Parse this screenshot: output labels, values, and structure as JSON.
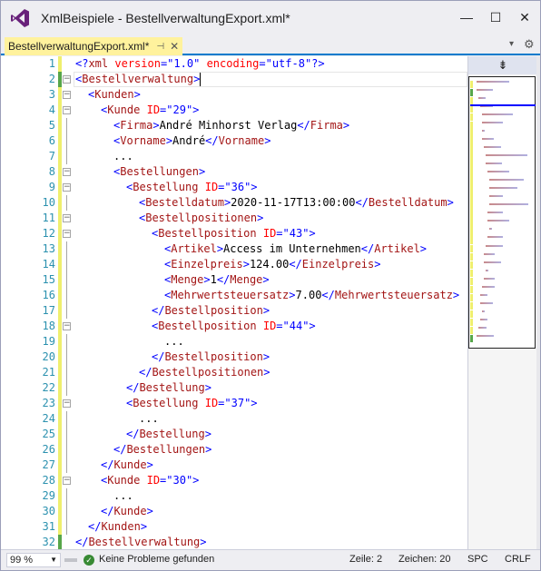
{
  "window": {
    "title": "XmlBeispiele - BestellverwaltungExport.xml*",
    "minimize_glyph": "—",
    "maximize_glyph": "☐",
    "close_glyph": "✕"
  },
  "tab": {
    "label": "BestellverwaltungExport.xml*",
    "pin_glyph": "⊣",
    "close_glyph": "✕",
    "dropdown_glyph": "▾",
    "gear_glyph": "⚙",
    "accent": "#fff29d"
  },
  "editor": {
    "lines": [
      {
        "n": "1",
        "indent": 0,
        "tokens": [
          [
            "b",
            "<?"
          ],
          [
            "el",
            "xml"
          ],
          [
            "tx",
            " "
          ],
          [
            "at",
            "version"
          ],
          [
            "b",
            "=\""
          ],
          [
            "av",
            "1.0"
          ],
          [
            "b",
            "\""
          ],
          [
            "tx",
            " "
          ],
          [
            "at",
            "encoding"
          ],
          [
            "b",
            "=\""
          ],
          [
            "av",
            "utf-8"
          ],
          [
            "b",
            "\"?>"
          ]
        ]
      },
      {
        "n": "2",
        "indent": 0,
        "fold": "−",
        "tokens": [
          [
            "b",
            "<"
          ],
          [
            "el",
            "Bestellverwaltung"
          ],
          [
            "b",
            ">"
          ]
        ],
        "caret": true
      },
      {
        "n": "3",
        "indent": 1,
        "fold": "−",
        "tokens": [
          [
            "b",
            "<"
          ],
          [
            "el",
            "Kunden"
          ],
          [
            "b",
            ">"
          ]
        ]
      },
      {
        "n": "4",
        "indent": 2,
        "fold": "−",
        "tokens": [
          [
            "b",
            "<"
          ],
          [
            "el",
            "Kunde"
          ],
          [
            "tx",
            " "
          ],
          [
            "at",
            "ID"
          ],
          [
            "b",
            "=\""
          ],
          [
            "av",
            "29"
          ],
          [
            "b",
            "\">"
          ]
        ]
      },
      {
        "n": "5",
        "indent": 3,
        "tokens": [
          [
            "b",
            "<"
          ],
          [
            "el",
            "Firma"
          ],
          [
            "b",
            ">"
          ],
          [
            "tx",
            "André Minhorst Verlag"
          ],
          [
            "b",
            "</"
          ],
          [
            "el",
            "Firma"
          ],
          [
            "b",
            ">"
          ]
        ]
      },
      {
        "n": "6",
        "indent": 3,
        "tokens": [
          [
            "b",
            "<"
          ],
          [
            "el",
            "Vorname"
          ],
          [
            "b",
            ">"
          ],
          [
            "tx",
            "André"
          ],
          [
            "b",
            "</"
          ],
          [
            "el",
            "Vorname"
          ],
          [
            "b",
            ">"
          ]
        ]
      },
      {
        "n": "7",
        "indent": 3,
        "tokens": [
          [
            "tx",
            "..."
          ]
        ]
      },
      {
        "n": "8",
        "indent": 3,
        "fold": "−",
        "tokens": [
          [
            "b",
            "<"
          ],
          [
            "el",
            "Bestellungen"
          ],
          [
            "b",
            ">"
          ]
        ]
      },
      {
        "n": "9",
        "indent": 4,
        "fold": "−",
        "tokens": [
          [
            "b",
            "<"
          ],
          [
            "el",
            "Bestellung"
          ],
          [
            "tx",
            " "
          ],
          [
            "at",
            "ID"
          ],
          [
            "b",
            "=\""
          ],
          [
            "av",
            "36"
          ],
          [
            "b",
            "\">"
          ]
        ]
      },
      {
        "n": "10",
        "indent": 5,
        "tokens": [
          [
            "b",
            "<"
          ],
          [
            "el",
            "Bestelldatum"
          ],
          [
            "b",
            ">"
          ],
          [
            "tx",
            "2020-11-17T13:00:00"
          ],
          [
            "b",
            "</"
          ],
          [
            "el",
            "Bestelldatum"
          ],
          [
            "b",
            ">"
          ]
        ]
      },
      {
        "n": "11",
        "indent": 5,
        "fold": "−",
        "tokens": [
          [
            "b",
            "<"
          ],
          [
            "el",
            "Bestellpositionen"
          ],
          [
            "b",
            ">"
          ]
        ]
      },
      {
        "n": "12",
        "indent": 6,
        "fold": "−",
        "tokens": [
          [
            "b",
            "<"
          ],
          [
            "el",
            "Bestellposition"
          ],
          [
            "tx",
            " "
          ],
          [
            "at",
            "ID"
          ],
          [
            "b",
            "=\""
          ],
          [
            "av",
            "43"
          ],
          [
            "b",
            "\">"
          ]
        ]
      },
      {
        "n": "13",
        "indent": 7,
        "tokens": [
          [
            "b",
            "<"
          ],
          [
            "el",
            "Artikel"
          ],
          [
            "b",
            ">"
          ],
          [
            "tx",
            "Access im Unternehmen"
          ],
          [
            "b",
            "</"
          ],
          [
            "el",
            "Artikel"
          ],
          [
            "b",
            ">"
          ]
        ]
      },
      {
        "n": "14",
        "indent": 7,
        "tokens": [
          [
            "b",
            "<"
          ],
          [
            "el",
            "Einzelpreis"
          ],
          [
            "b",
            ">"
          ],
          [
            "tx",
            "124.00"
          ],
          [
            "b",
            "</"
          ],
          [
            "el",
            "Einzelpreis"
          ],
          [
            "b",
            ">"
          ]
        ]
      },
      {
        "n": "15",
        "indent": 7,
        "tokens": [
          [
            "b",
            "<"
          ],
          [
            "el",
            "Menge"
          ],
          [
            "b",
            ">"
          ],
          [
            "tx",
            "1"
          ],
          [
            "b",
            "</"
          ],
          [
            "el",
            "Menge"
          ],
          [
            "b",
            ">"
          ]
        ]
      },
      {
        "n": "16",
        "indent": 7,
        "tokens": [
          [
            "b",
            "<"
          ],
          [
            "el",
            "Mehrwertsteuersatz"
          ],
          [
            "b",
            ">"
          ],
          [
            "tx",
            "7.00"
          ],
          [
            "b",
            "</"
          ],
          [
            "el",
            "Mehrwertsteuersatz"
          ],
          [
            "b",
            ">"
          ]
        ]
      },
      {
        "n": "17",
        "indent": 6,
        "tokens": [
          [
            "b",
            "</"
          ],
          [
            "el",
            "Bestellposition"
          ],
          [
            "b",
            ">"
          ]
        ]
      },
      {
        "n": "18",
        "indent": 6,
        "fold": "−",
        "tokens": [
          [
            "b",
            "<"
          ],
          [
            "el",
            "Bestellposition"
          ],
          [
            "tx",
            " "
          ],
          [
            "at",
            "ID"
          ],
          [
            "b",
            "=\""
          ],
          [
            "av",
            "44"
          ],
          [
            "b",
            "\">"
          ]
        ]
      },
      {
        "n": "19",
        "indent": 7,
        "tokens": [
          [
            "tx",
            "..."
          ]
        ]
      },
      {
        "n": "20",
        "indent": 6,
        "tokens": [
          [
            "b",
            "</"
          ],
          [
            "el",
            "Bestellposition"
          ],
          [
            "b",
            ">"
          ]
        ]
      },
      {
        "n": "21",
        "indent": 5,
        "tokens": [
          [
            "b",
            "</"
          ],
          [
            "el",
            "Bestellpositionen"
          ],
          [
            "b",
            ">"
          ]
        ]
      },
      {
        "n": "22",
        "indent": 4,
        "tokens": [
          [
            "b",
            "</"
          ],
          [
            "el",
            "Bestellung"
          ],
          [
            "b",
            ">"
          ]
        ]
      },
      {
        "n": "23",
        "indent": 4,
        "fold": "−",
        "tokens": [
          [
            "b",
            "<"
          ],
          [
            "el",
            "Bestellung"
          ],
          [
            "tx",
            " "
          ],
          [
            "at",
            "ID"
          ],
          [
            "b",
            "=\""
          ],
          [
            "av",
            "37"
          ],
          [
            "b",
            "\">"
          ]
        ]
      },
      {
        "n": "24",
        "indent": 5,
        "tokens": [
          [
            "tx",
            "..."
          ]
        ]
      },
      {
        "n": "25",
        "indent": 4,
        "tokens": [
          [
            "b",
            "</"
          ],
          [
            "el",
            "Bestellung"
          ],
          [
            "b",
            ">"
          ]
        ]
      },
      {
        "n": "26",
        "indent": 3,
        "tokens": [
          [
            "b",
            "</"
          ],
          [
            "el",
            "Bestellungen"
          ],
          [
            "b",
            ">"
          ]
        ]
      },
      {
        "n": "27",
        "indent": 2,
        "tokens": [
          [
            "b",
            "</"
          ],
          [
            "el",
            "Kunde"
          ],
          [
            "b",
            ">"
          ]
        ]
      },
      {
        "n": "28",
        "indent": 2,
        "fold": "−",
        "tokens": [
          [
            "b",
            "<"
          ],
          [
            "el",
            "Kunde"
          ],
          [
            "tx",
            " "
          ],
          [
            "at",
            "ID"
          ],
          [
            "b",
            "=\""
          ],
          [
            "av",
            "30"
          ],
          [
            "b",
            "\">"
          ]
        ]
      },
      {
        "n": "29",
        "indent": 3,
        "tokens": [
          [
            "tx",
            "..."
          ]
        ]
      },
      {
        "n": "30",
        "indent": 2,
        "tokens": [
          [
            "b",
            "</"
          ],
          [
            "el",
            "Kunde"
          ],
          [
            "b",
            ">"
          ]
        ]
      },
      {
        "n": "31",
        "indent": 1,
        "tokens": [
          [
            "b",
            "</"
          ],
          [
            "el",
            "Kunden"
          ],
          [
            "b",
            ">"
          ]
        ]
      },
      {
        "n": "32",
        "indent": 0,
        "tokens": [
          [
            "b",
            "</"
          ],
          [
            "el",
            "Bestellverwaltung"
          ],
          [
            "b",
            ">"
          ]
        ]
      }
    ],
    "change_marks": {
      "saved": [
        "2",
        "32"
      ],
      "unsaved_color": "#efef6e",
      "saved_color": "#57a64a"
    }
  },
  "minimap": {
    "split_glyph": "⇟"
  },
  "status": {
    "zoom": "99 %",
    "problems": "Keine Probleme gefunden",
    "line": "Zeile: 2",
    "chars": "Zeichen: 20",
    "whitespace": "SPC",
    "line_ending": "CRLF"
  }
}
